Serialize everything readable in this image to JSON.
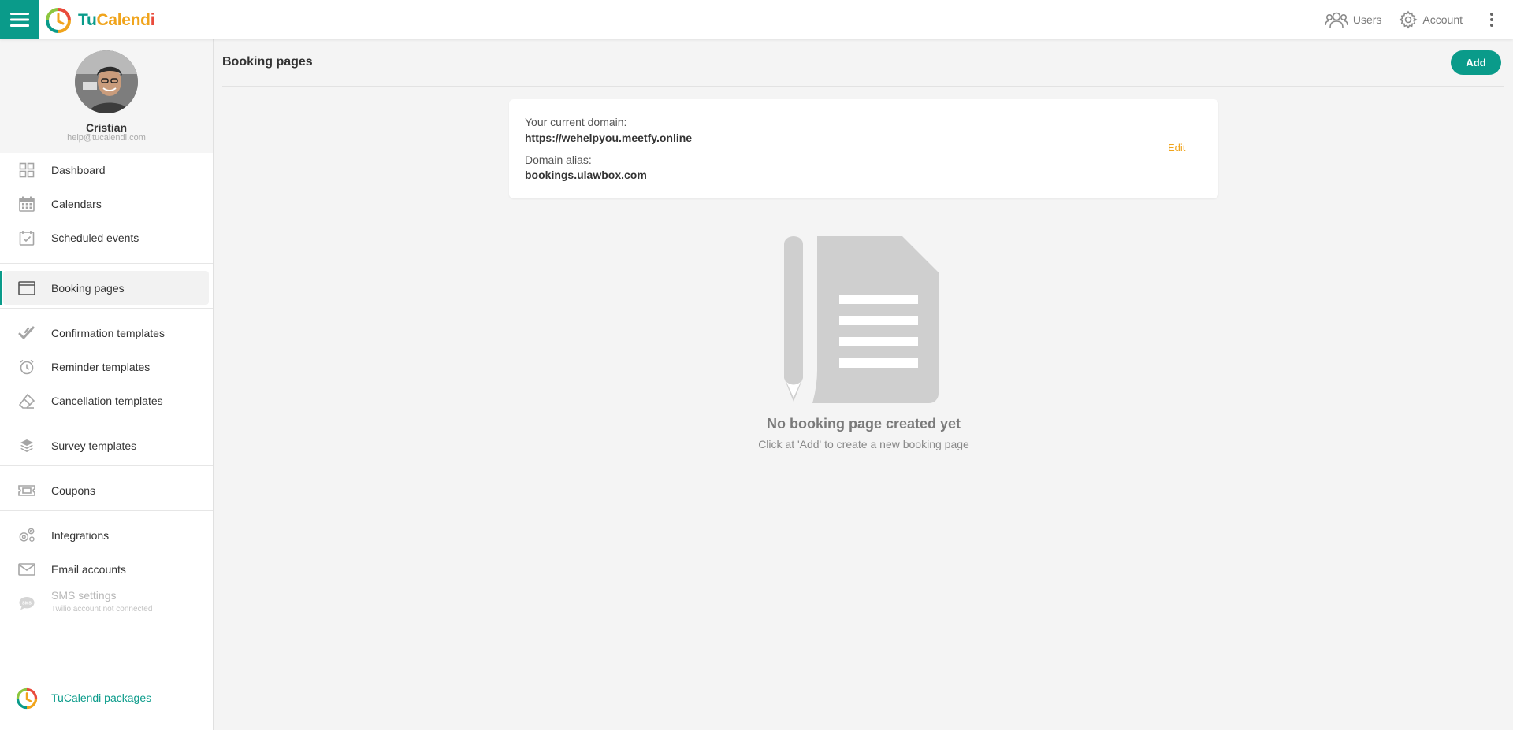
{
  "app": {
    "brand_tu": "Tu",
    "brand_cal": "Calend",
    "brand_i": "i"
  },
  "header": {
    "users_label": "Users",
    "account_label": "Account"
  },
  "profile": {
    "name": "Cristian",
    "email": "help@tucalendi.com"
  },
  "sidebar": {
    "items": [
      {
        "label": "Dashboard",
        "icon": "dashboard-icon"
      },
      {
        "label": "Calendars",
        "icon": "calendar-icon"
      },
      {
        "label": "Scheduled events",
        "icon": "calendar-check-icon"
      },
      {
        "label": "Booking pages",
        "icon": "browser-window-icon",
        "active": true
      },
      {
        "label": "Confirmation templates",
        "icon": "double-check-icon"
      },
      {
        "label": "Reminder templates",
        "icon": "alarm-clock-icon"
      },
      {
        "label": "Cancellation templates",
        "icon": "eraser-icon"
      },
      {
        "label": "Survey templates",
        "icon": "layers-icon"
      },
      {
        "label": "Coupons",
        "icon": "ticket-icon"
      },
      {
        "label": "Integrations",
        "icon": "gears-icon"
      },
      {
        "label": "Email accounts",
        "icon": "envelope-icon"
      },
      {
        "label": "SMS settings",
        "sublabel": "Twilio account not connected",
        "icon": "sms-bubble-icon",
        "disabled": true
      }
    ],
    "packages_label": "TuCalendi packages"
  },
  "main": {
    "title": "Booking pages",
    "add_label": "Add",
    "domain_card": {
      "current_domain_label": "Your current domain:",
      "current_domain_value": "https://wehelpyou.meetfy.online",
      "alias_label": "Domain alias:",
      "alias_value": "bookings.ulawbox.com",
      "edit_label": "Edit"
    },
    "empty_state": {
      "title": "No booking page created yet",
      "subtitle": "Click at 'Add' to create a new booking page"
    }
  },
  "colors": {
    "accent": "#0a9b8a",
    "edit": "#f0a41c",
    "icon_gray": "#9e9e9e"
  }
}
